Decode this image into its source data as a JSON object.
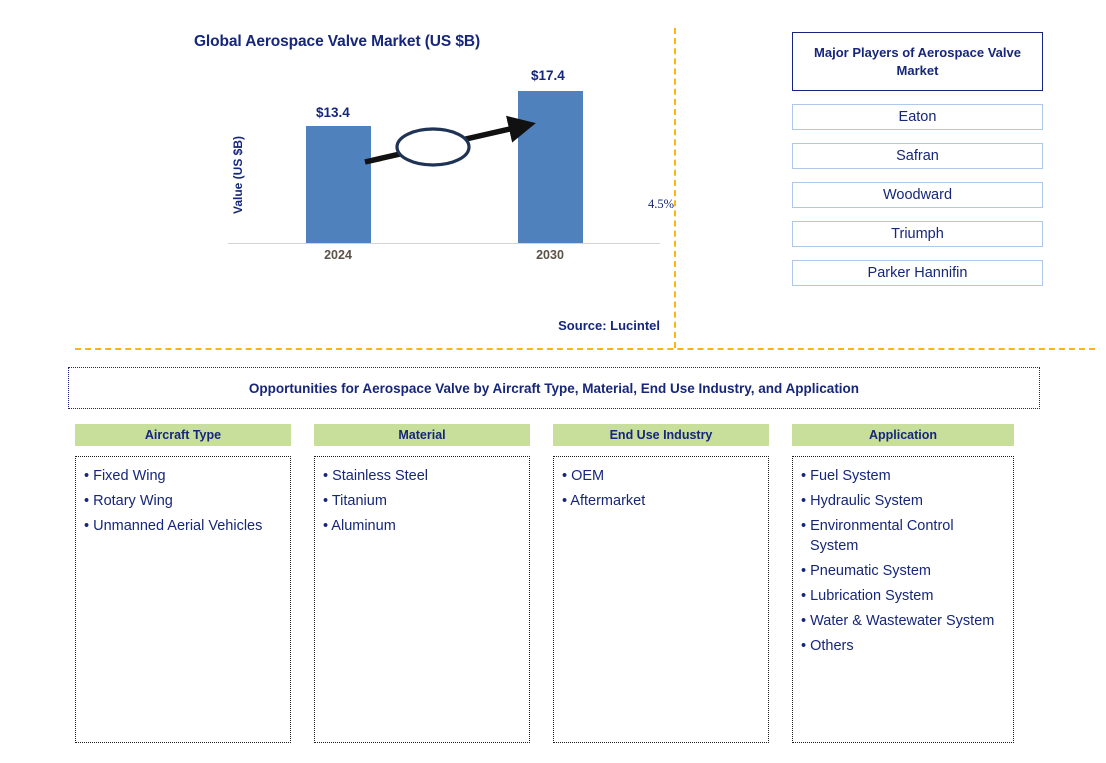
{
  "chart_data": {
    "type": "bar",
    "title": "Global Aerospace Valve Market (US $B)",
    "xlabel": "",
    "ylabel": "Value (US $B)",
    "categories": [
      "2024",
      "2030"
    ],
    "values": [
      13.4,
      17.4
    ],
    "value_labels": [
      "$13.4",
      "$17.4"
    ],
    "annotation": "4.5%",
    "annotation_type": "CAGR arrow between 2024 and 2030",
    "ylim": [
      0,
      21
    ],
    "grid": false,
    "legend": "none",
    "series_color": "#4F81BD",
    "source": "Source: Lucintel"
  },
  "players": {
    "header": "Major Players of Aerospace Valve Market",
    "items": [
      {
        "label": "Eaton"
      },
      {
        "label": "Safran"
      },
      {
        "label": "Woodward"
      },
      {
        "label": "Triumph"
      },
      {
        "label": "Parker Hannifin"
      }
    ]
  },
  "opportunities": {
    "banner": "Opportunities for Aerospace Valve by Aircraft Type, Material, End Use Industry, and Application",
    "columns": [
      {
        "header": "Aircraft Type",
        "items": [
          "Fixed Wing",
          "Rotary Wing",
          "Unmanned Aerial Vehicles"
        ]
      },
      {
        "header": "Material",
        "items": [
          "Stainless Steel",
          "Titanium",
          "Aluminum"
        ]
      },
      {
        "header": "End Use Industry",
        "items": [
          "OEM",
          "Aftermarket"
        ]
      },
      {
        "header": "Application",
        "items": [
          "Fuel System",
          "Hydraulic System",
          "Environmental Control System",
          "Pneumatic System",
          "Lubrication System",
          "Water & Wastewater System",
          "Others"
        ]
      }
    ]
  },
  "colors": {
    "bar": "#4F81BD",
    "navy": "#16267A",
    "divider_orange": "#FFB511",
    "header_green": "#C7DF9B",
    "tick_gray": "#5B5248"
  }
}
